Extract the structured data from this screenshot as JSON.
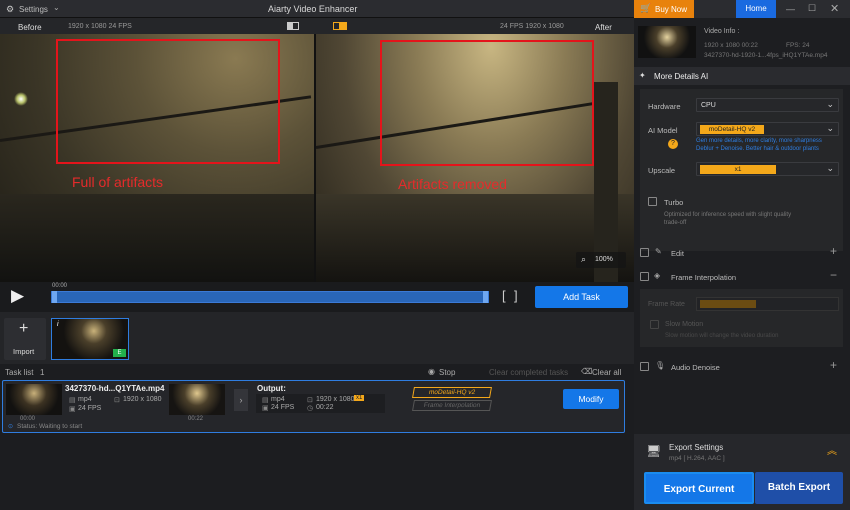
{
  "app": {
    "title": "Aiarty Video Enhancer",
    "settings_label": "Settings",
    "buy_label": "Buy Now",
    "home_label": "Home"
  },
  "preview": {
    "before_label": "Before",
    "after_label": "After",
    "left_info": "1920 x 1080  24 FPS",
    "right_info": "24 FPS  1920 x 1080",
    "left_annotation": "Full of artifacts",
    "right_annotation": "Artifacts removed",
    "zoom": "100%"
  },
  "controls": {
    "time": "00:00",
    "add_task_label": "Add Task"
  },
  "timeline": {
    "import_label": "Import",
    "badge": "E"
  },
  "tasks": {
    "header": "Task list",
    "count": "1",
    "stop_label": "Stop",
    "clear_completed_label": "Clear completed tasks",
    "clear_all_label": "Clear all",
    "item": {
      "name": "3427370-hd...Q1YTAe.mp4",
      "format": "mp4",
      "resolution": "1920 x 1080",
      "fps": "24 FPS",
      "thumb_time_left": "00:00",
      "thumb_time_right": "00:22",
      "output_label": "Output:",
      "out_format": "mp4",
      "out_resolution": "1920 x 1080",
      "out_scale": "x1",
      "out_fps": "24 FPS",
      "out_duration": "00:22",
      "model_chip": "moDetail-HQ  v2",
      "interp_chip": "Frame Interpolation",
      "modify_label": "Modify",
      "status": "Status: Waiting to start"
    }
  },
  "right": {
    "video_info_label": "Video Info :",
    "video_res": "1920 x 1080  00:22",
    "video_fps": "FPS: 24",
    "video_file": "3427370-hd-1920-1...4fps_iHQ1YTAe.mp4",
    "more_details_label": "More Details AI",
    "hardware_label": "Hardware",
    "hardware_value": "CPU",
    "ai_model_label": "AI Model",
    "ai_model_value": "moDetail-HQ  v2",
    "model_desc": "Gen more details, more clarity, more sharpness\nDeblur + Denoise. Better hair & outdoor plants",
    "upscale_label": "Upscale",
    "upscale_value": "x1",
    "turbo_label": "Turbo",
    "turbo_desc": "Optimized for inference speed with slight quality trade-off",
    "edit_label": "Edit",
    "frame_interp_label": "Frame Interpolation",
    "frame_rate_label": "Frame Rate",
    "slow_motion_label": "Slow Motion",
    "slow_motion_desc": "Slow motion will change the video duration",
    "audio_denoise_label": "Audio Denoise",
    "export_settings_label": "Export Settings",
    "export_format": "mp4 [ H.264, AAC ]",
    "export_current_label": "Export Current",
    "batch_export_label": "Batch Export"
  }
}
